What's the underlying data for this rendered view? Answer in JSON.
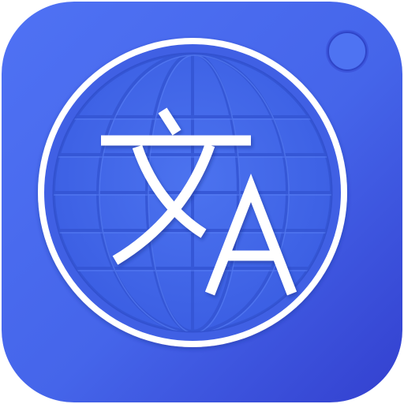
{
  "app_icon": {
    "name": "translator-app-icon",
    "glyphs": {
      "chinese": "文",
      "latin": "A"
    },
    "colors": {
      "background": "#ffffff",
      "tile_light": "#4a6cf0",
      "tile_dark": "#3443d6",
      "ring": "#ffffff",
      "globe_fill": "#3f63e6",
      "globe_inner": "#4b71ee",
      "globe_lines": "#3556d4",
      "glyph": "#ffffff",
      "camera_dot": "#4e73f2"
    },
    "icons": [
      "globe-icon",
      "translate-icon",
      "camera-dot-icon"
    ]
  }
}
